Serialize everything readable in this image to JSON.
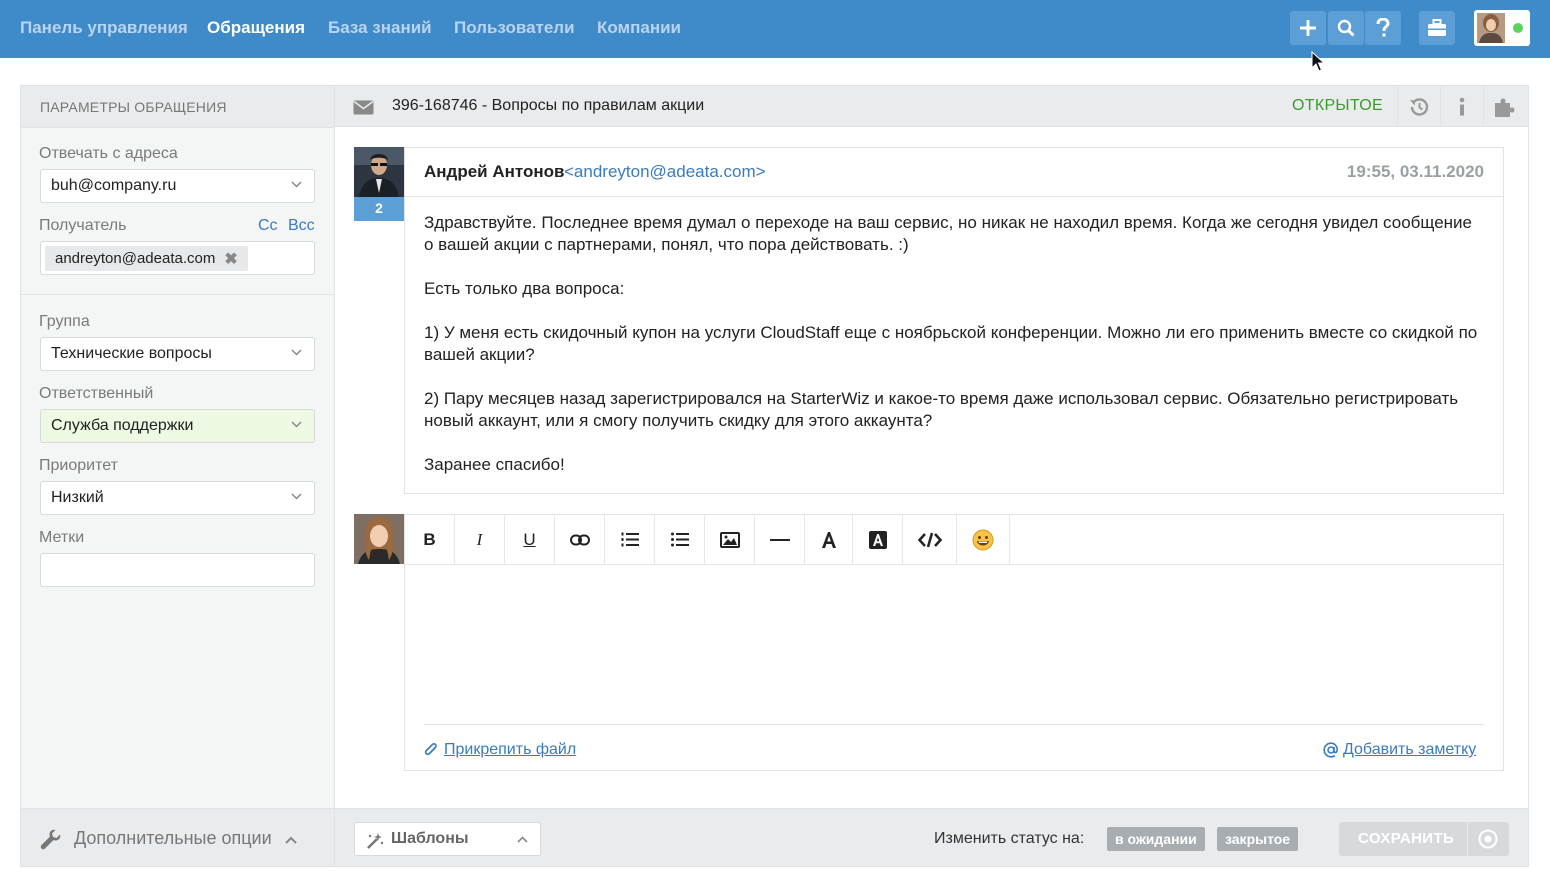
{
  "nav": {
    "items": [
      "Панель управления",
      "Обращения",
      "База знаний",
      "Пользователи",
      "Компании"
    ],
    "active_index": 1,
    "icons": [
      "plus-icon",
      "search-icon",
      "help-icon",
      "briefcase-icon"
    ]
  },
  "sidebar": {
    "title": "ПАРАМЕТРЫ ОБРАЩЕНИЯ",
    "reply_from_label": "Отвечать с адреса",
    "reply_from_value": "buh@company.ru",
    "recipient_label": "Получатель",
    "cc_label": "Cc",
    "bcc_label": "Bcc",
    "recipient_tag": "andreyton@adeata.com",
    "group_label": "Группа",
    "group_value": "Технические вопросы",
    "assignee_label": "Ответственный",
    "assignee_value": "Служба поддержки",
    "priority_label": "Приоритет",
    "priority_value": "Низкий",
    "tags_label": "Метки",
    "tags_value": "",
    "extra_options": "Дополнительные опции"
  },
  "ticket": {
    "title": "396-168746 - Вопросы по правилам акции",
    "status": "ОТКРЫТОЕ"
  },
  "message": {
    "count": "2",
    "author": "Андрей Антонов",
    "email": "<andreyton@adeata.com>",
    "date": "19:55, 03.11.2020",
    "paragraphs": [
      "Здравствуйте. Последнее время думал о переходе на ваш сервис, но никак не находил время. Когда же сегодня увидел сообщение о вашей акции с партнерами, понял, что пора действовать. :)",
      "Есть только два вопроса:",
      "1) У меня есть скидочный купон на услуги CloudStaff еще с ноябрьской конференции. Можно ли его применить вместе со скидкой по вашей акции?",
      "2) Пару месяцев назад зарегистрировался на StarterWiz и какое-то время даже использовал сервис. Обязательно регистрировать новый аккаунт, или я смогу получить скидку для этого аккаунта?",
      "Заранее спасибо!"
    ]
  },
  "editor": {
    "toolbar": {
      "bold": "B",
      "italic": "I",
      "underline": "U"
    },
    "attach_label": "Прикрепить файл",
    "note_label": "Добавить заметку"
  },
  "footer": {
    "templates_label": "Шаблоны",
    "change_status_label": "Изменить статус на:",
    "status_pending": "в ожидании",
    "status_closed": "закрытое",
    "save_label": "СОХРАНИТЬ"
  },
  "colors": {
    "topbar": "#3f8ac8",
    "accent": "#5c9fd6",
    "status_open": "#3d9a2e",
    "link": "#3a7bbf"
  }
}
